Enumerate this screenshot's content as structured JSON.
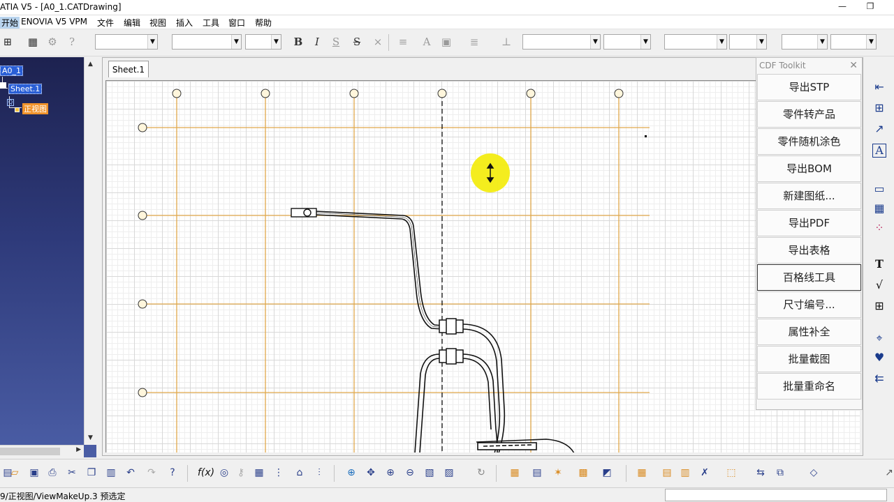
{
  "window": {
    "title": "ATIA V5 - [A0_1.CATDrawing]",
    "minimize_glyph": "—",
    "restore_glyph": "❐"
  },
  "menu": {
    "items": [
      "开始",
      "ENOVIA V5 VPM",
      "文件",
      "编辑",
      "视图",
      "插入",
      "工具",
      "窗口",
      "帮助"
    ]
  },
  "toolbar": {
    "bold": "B",
    "italic": "I",
    "strike": "S",
    "text_icon": "A"
  },
  "tree": {
    "root": "A0_1",
    "sheet": "Sheet.1",
    "view": "正视图"
  },
  "drawing": {
    "sheet_tab": "Sheet.1"
  },
  "cdf_toolkit": {
    "title": "CDF Toolkit",
    "close_glyph": "✕",
    "buttons": [
      "导出STP",
      "零件转产品",
      "零件随机涂色",
      "导出BOM",
      "新建图纸...",
      "导出PDF",
      "导出表格",
      "百格线工具",
      "尺寸编号...",
      "属性补全",
      "批量截图",
      "批量重命名"
    ],
    "active_index": 7
  },
  "right_toolbar": {
    "icons": [
      "dimension-icon",
      "dimension-chain-icon",
      "cumulated-dim-icon",
      "text-frame-icon",
      "rectangle-icon",
      "table-icon",
      "point-icon",
      "text-icon",
      "roughness-icon",
      "grid-table-icon",
      "axis-icon",
      "hatch-icon",
      "arrow-left-icon"
    ],
    "text_glyph": "T",
    "frame_glyph": "A"
  },
  "bottom_toolbar": {
    "formula_glyph": "f(x)"
  },
  "status": {
    "text": "9/正视图/ViewMakeUp.3 预选定"
  },
  "colors": {
    "grid_line": "#e0a84a",
    "cursor_highlight": "#f3ec12",
    "tree_bg": "#2e3a7a",
    "view_node": "#f0932b"
  }
}
